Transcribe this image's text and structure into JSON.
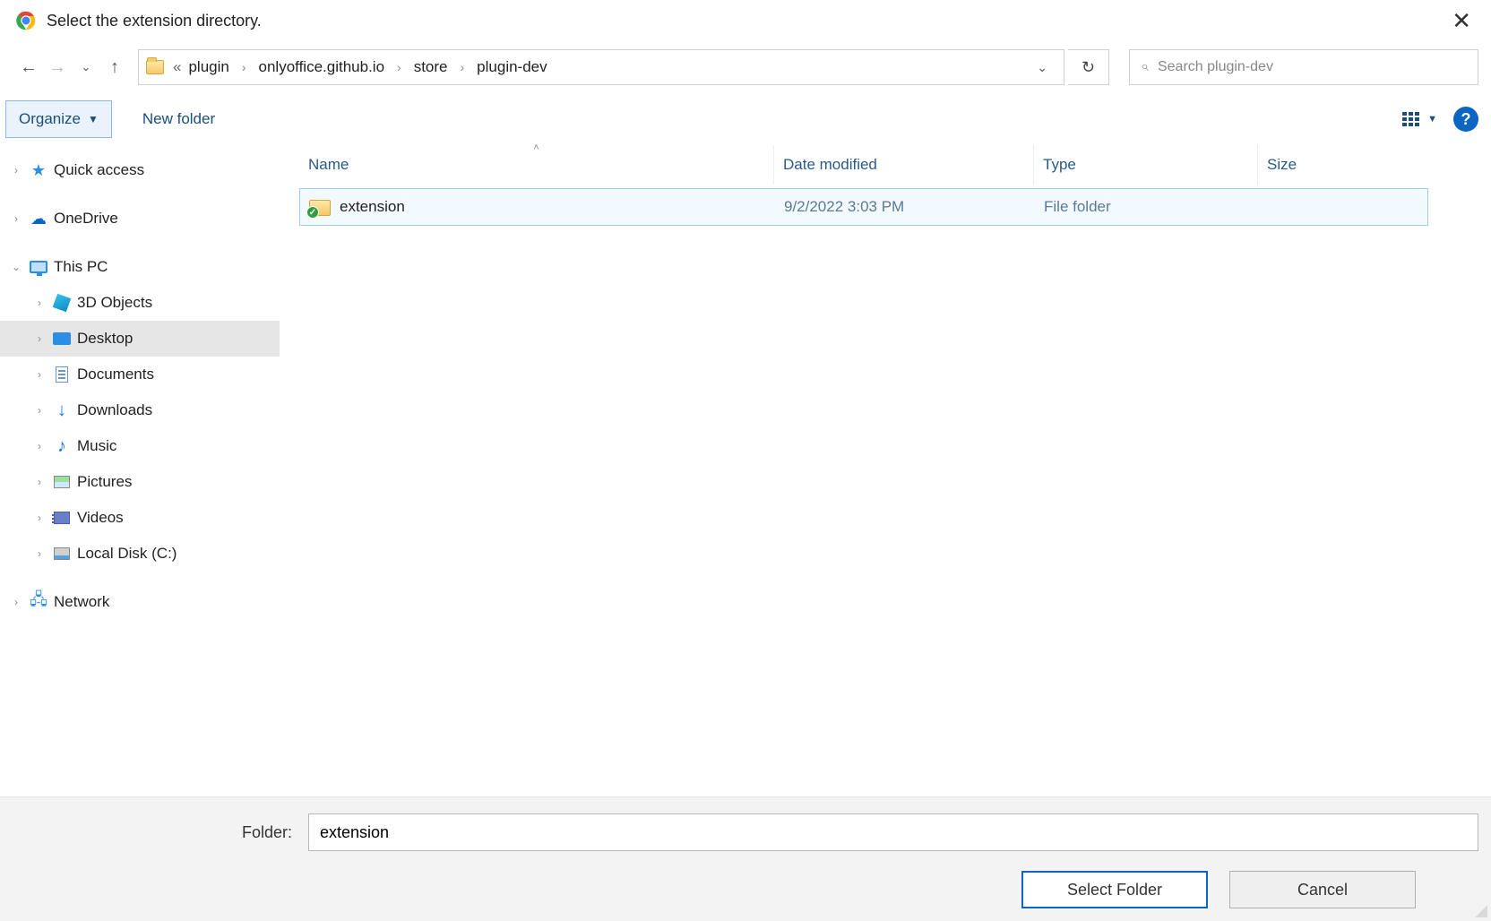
{
  "title": "Select the extension directory.",
  "breadcrumb": {
    "segments": [
      "plugin",
      "onlyoffice.github.io",
      "store",
      "plugin-dev"
    ]
  },
  "search": {
    "placeholder": "Search plugin-dev"
  },
  "toolbar": {
    "organize_label": "Organize",
    "newfolder_label": "New folder"
  },
  "columns": {
    "name": "Name",
    "date": "Date modified",
    "type": "Type",
    "size": "Size"
  },
  "rows": [
    {
      "name": "extension",
      "date": "9/2/2022 3:03 PM",
      "type": "File folder"
    }
  ],
  "sidebar": {
    "quick_access": "Quick access",
    "onedrive": "OneDrive",
    "this_pc": "This PC",
    "children": {
      "objects3d": "3D Objects",
      "desktop": "Desktop",
      "documents": "Documents",
      "downloads": "Downloads",
      "music": "Music",
      "pictures": "Pictures",
      "videos": "Videos",
      "localdisk": "Local Disk (C:)"
    },
    "network": "Network"
  },
  "bottom": {
    "folder_label": "Folder:",
    "folder_value": "extension",
    "select_label": "Select Folder",
    "cancel_label": "Cancel"
  }
}
